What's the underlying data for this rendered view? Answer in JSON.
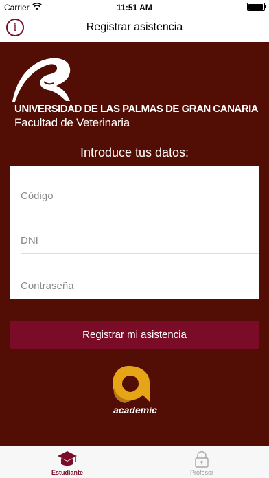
{
  "status_bar": {
    "carrier": "Carrier",
    "time": "11:51 AM",
    "icons": [
      "wifi-icon",
      "battery-icon"
    ]
  },
  "nav": {
    "title": "Registrar asistencia",
    "info_icon_glyph": "i"
  },
  "brand": {
    "university": "UNIVERSIDAD DE LAS PALMAS DE GRAN CANARIA",
    "faculty": "Facultad de Veterinaria"
  },
  "form": {
    "prompt": "Introduce tus datos:",
    "codigo_placeholder": "Código",
    "dni_placeholder": "DNI",
    "password_placeholder": "Contraseña",
    "codigo_value": "",
    "dni_value": "",
    "password_value": ""
  },
  "submit": {
    "label": "Registrar mi asistencia"
  },
  "footer_logo": {
    "text": "academic"
  },
  "tabs": [
    {
      "label": "Estudiante",
      "icon": "graduation-cap-icon",
      "active": true
    },
    {
      "label": "Profesor",
      "icon": "padlock-icon",
      "active": false
    }
  ],
  "colors": {
    "background": "#520d05",
    "accent": "#7a0c28",
    "logo_gold": "#e6a417"
  }
}
